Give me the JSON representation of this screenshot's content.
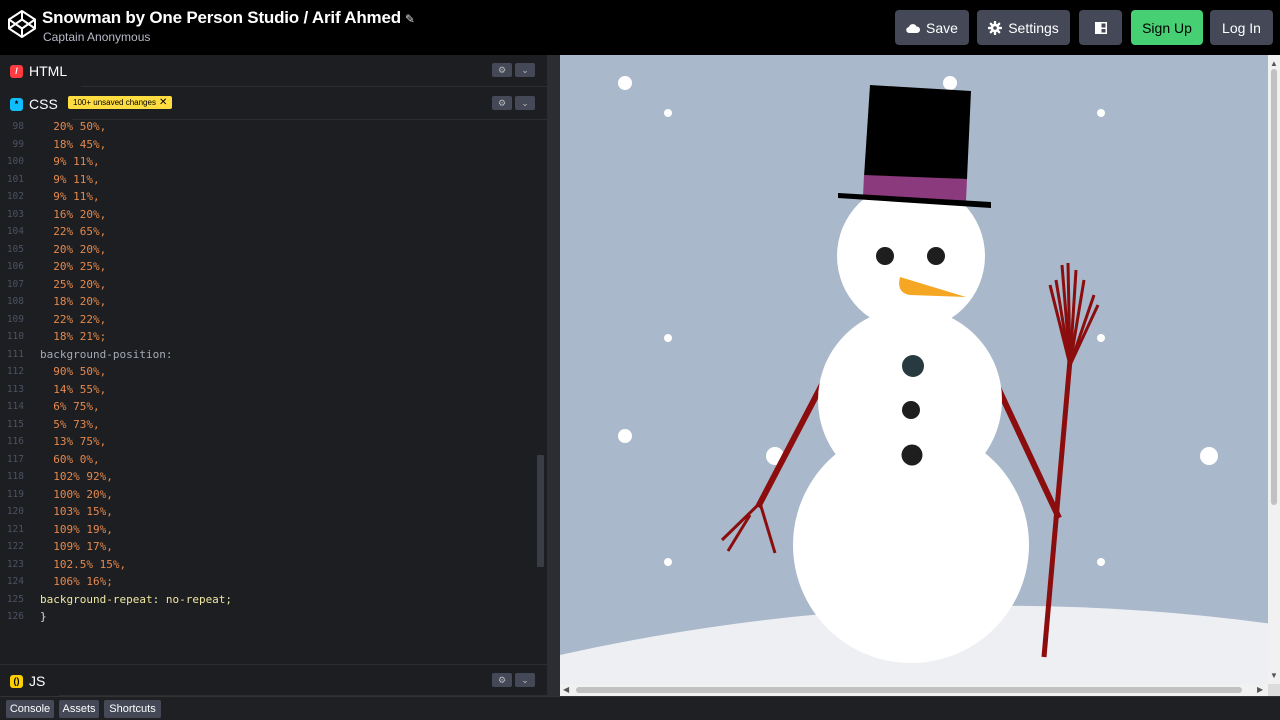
{
  "header": {
    "title": "Snowman by One Person Studio / Arif Ahmed",
    "subtitle": "Captain Anonymous",
    "buttons": {
      "save": "Save",
      "settings": "Settings",
      "signup": "Sign Up",
      "login": "Log In"
    }
  },
  "panes": {
    "html": {
      "label": "HTML"
    },
    "css": {
      "label": "CSS",
      "badge": "100+ unsaved changes"
    },
    "js": {
      "label": "JS"
    }
  },
  "code": [
    {
      "n": "98",
      "t": "  20% 50%,",
      "c": "v"
    },
    {
      "n": "99",
      "t": "  18% 45%,",
      "c": "v"
    },
    {
      "n": "100",
      "t": "  9% 11%,",
      "c": "v"
    },
    {
      "n": "101",
      "t": "  9% 11%,",
      "c": "v"
    },
    {
      "n": "102",
      "t": "  9% 11%,",
      "c": "v"
    },
    {
      "n": "103",
      "t": "  16% 20%,",
      "c": "v"
    },
    {
      "n": "104",
      "t": "  22% 65%,",
      "c": "v"
    },
    {
      "n": "105",
      "t": "  20% 20%,",
      "c": "v"
    },
    {
      "n": "106",
      "t": "  20% 25%,",
      "c": "v"
    },
    {
      "n": "107",
      "t": "  25% 20%,",
      "c": "v"
    },
    {
      "n": "108",
      "t": "  18% 20%,",
      "c": "v"
    },
    {
      "n": "109",
      "t": "  22% 22%,",
      "c": "v"
    },
    {
      "n": "110",
      "t": "  18% 21%;",
      "c": "v"
    },
    {
      "n": "111",
      "t": "background-position:",
      "c": "k"
    },
    {
      "n": "112",
      "t": "  90% 50%,",
      "c": "v"
    },
    {
      "n": "113",
      "t": "  14% 55%,",
      "c": "v"
    },
    {
      "n": "114",
      "t": "  6% 75%,",
      "c": "v"
    },
    {
      "n": "115",
      "t": "  5% 73%,",
      "c": "v"
    },
    {
      "n": "116",
      "t": "  13% 75%,",
      "c": "v"
    },
    {
      "n": "117",
      "t": "  60% 0%,",
      "c": "v"
    },
    {
      "n": "118",
      "t": "  102% 92%,",
      "c": "v"
    },
    {
      "n": "119",
      "t": "  100% 20%,",
      "c": "v"
    },
    {
      "n": "120",
      "t": "  103% 15%,",
      "c": "v"
    },
    {
      "n": "121",
      "t": "  109% 19%,",
      "c": "v"
    },
    {
      "n": "122",
      "t": "  109% 17%,",
      "c": "v"
    },
    {
      "n": "123",
      "t": "  102.5% 15%,",
      "c": "v"
    },
    {
      "n": "124",
      "t": "  106% 16%;",
      "c": "v"
    },
    {
      "n": "125",
      "t": "background-repeat: no-repeat;",
      "c": "kw"
    },
    {
      "n": "126",
      "t": "}",
      "c": "p"
    }
  ],
  "footer": {
    "console": "Console",
    "assets": "Assets",
    "shortcuts": "Shortcuts"
  },
  "colors": {
    "sky": "#a9b8ca",
    "snow": "#ffffff",
    "hat": "#000000",
    "hat_band": "#8b3a7e",
    "carrot": "#f5a623",
    "stick": "#8b0d0d",
    "signup": "#47cf73",
    "badge": "#ffdd40"
  }
}
